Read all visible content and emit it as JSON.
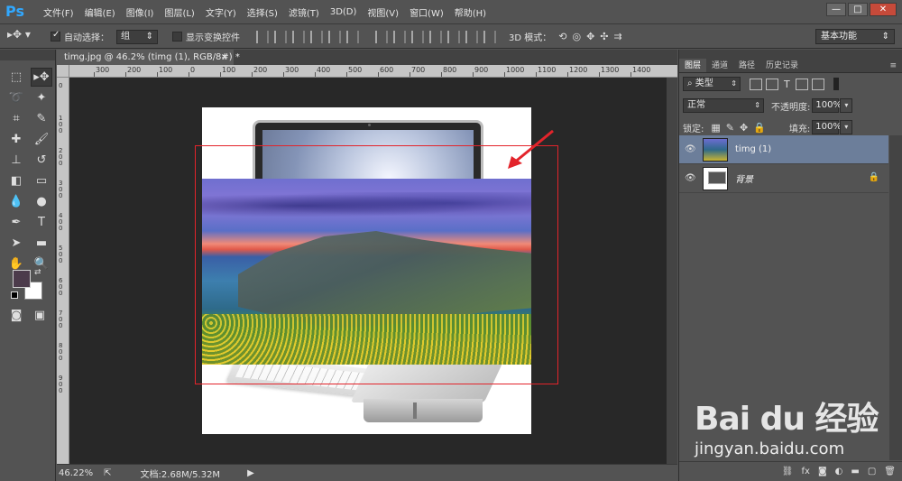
{
  "app": {
    "logo": "Ps"
  },
  "menu": [
    "文件(F)",
    "编辑(E)",
    "图像(I)",
    "图层(L)",
    "文字(Y)",
    "选择(S)",
    "滤镜(T)",
    "3D(D)",
    "视图(V)",
    "窗口(W)",
    "帮助(H)"
  ],
  "window_buttons": {
    "minimize": "—",
    "restore": "□",
    "close": "✕"
  },
  "options": {
    "auto_select_label": "自动选择：",
    "auto_select_value": "组",
    "show_transform_label": "显示变换控件",
    "mode_3d_label": "3D 模式：",
    "workspace": "基本功能"
  },
  "document": {
    "tab_title": "timg.jpg @ 46.2% (timg (1), RGB/8#) *",
    "close": "×",
    "ruler_top": [
      "300",
      "200",
      "100",
      "0",
      "100",
      "200",
      "300",
      "400",
      "500",
      "600",
      "700",
      "800",
      "900",
      "1000",
      "1100",
      "1200",
      "1300",
      "1400"
    ],
    "ruler_left": [
      "0",
      "1 0 0",
      "2 0 0",
      "3 0 0",
      "4 0 0",
      "5 0 0",
      "6 0 0",
      "7 0 0",
      "8 0 0",
      "9 0 0"
    ]
  },
  "status": {
    "zoom": "46.22%",
    "doc_info": "文档:2.68M/5.32M"
  },
  "layers_panel": {
    "tabs": [
      "图层",
      "通道",
      "路径",
      "历史记录"
    ],
    "filter_kind": "类型",
    "blend_mode": "正常",
    "opacity_label": "不透明度:",
    "opacity_value": "100%",
    "lock_label": "锁定:",
    "fill_label": "填充:",
    "fill_value": "100%",
    "layers": [
      {
        "name": "timg (1)",
        "selected": true
      },
      {
        "name": "背景",
        "selected": false,
        "locked": true
      }
    ],
    "bottom_icons": [
      "link-icon",
      "fx-icon",
      "mask-icon",
      "adjustment-icon",
      "group-icon",
      "new-layer-icon",
      "delete-icon"
    ]
  },
  "watermark": {
    "brand": "Bai du 经验",
    "url": "jingyan.baidu.com"
  },
  "colors": {
    "foreground": "#4c3b4b",
    "background": "#ffffff",
    "selection_box": "#e3242b",
    "selected_layer": "#6c7e9a"
  }
}
